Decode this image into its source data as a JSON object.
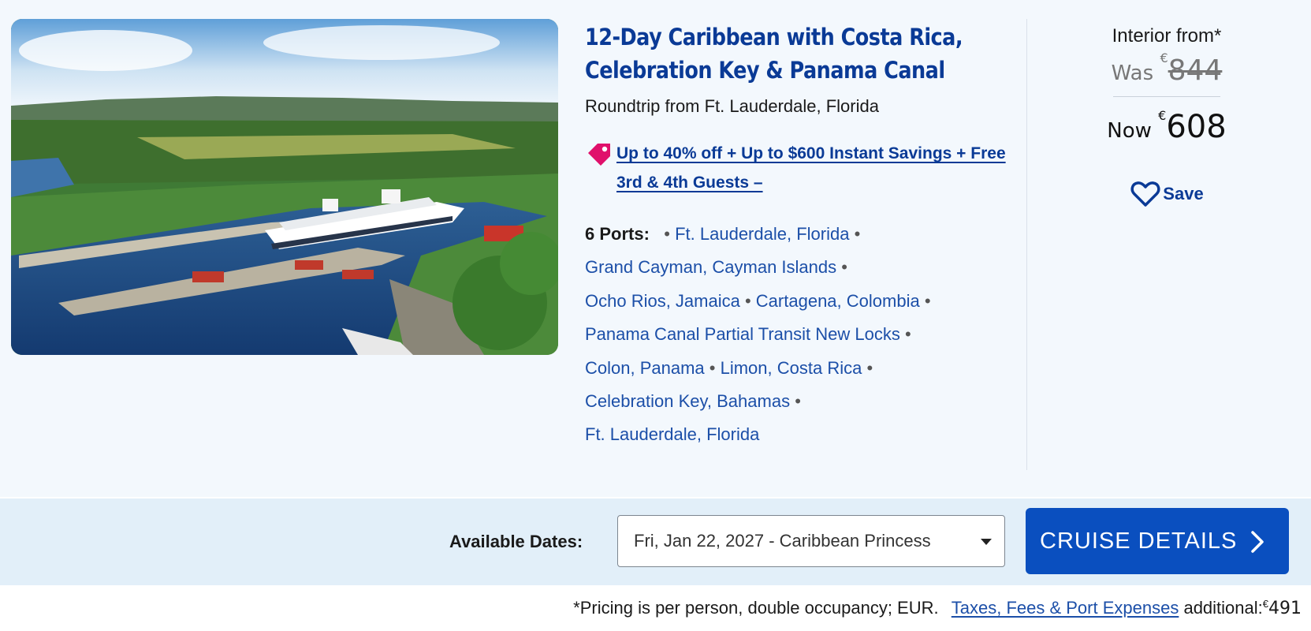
{
  "cruise": {
    "title": "12-Day Caribbean with Costa Rica, Celebration Key & Panama Canal",
    "subtitle": "Roundtrip from Ft. Lauderdale, Florida",
    "promo": "Up to 40% off + Up to $600 Instant Savings + Free 3rd & 4th Guests –",
    "ports_label": "6 Ports:",
    "ports": [
      "Ft. Lauderdale, Florida",
      "Grand Cayman, Cayman Islands",
      "Ocho Rios, Jamaica",
      "Cartagena, Colombia",
      "Panama Canal Partial Transit New Locks",
      "Colon, Panama",
      "Limon, Costa Rica",
      "Celebration Key, Bahamas",
      "Ft. Lauderdale, Florida"
    ]
  },
  "pricing": {
    "label": "Interior from*",
    "was_label": "Was",
    "currency": "€",
    "was_amount": "844",
    "now_label": "Now",
    "now_amount": "608",
    "save_label": "Save"
  },
  "dates": {
    "label": "Available Dates:",
    "selected": "Fri, Jan 22, 2027 - Caribbean Princess",
    "cta": "CRUISE DETAILS"
  },
  "footer": {
    "note": "*Pricing is per person, double occupancy; EUR.",
    "fees_link": "Taxes, Fees & Port Expenses",
    "fees_suffix": "additional:",
    "fees_currency": "€",
    "fees_amount": "491"
  },
  "colors": {
    "brand": "#0a3a96",
    "cta": "#0a4fbf",
    "tag": "#e0106b",
    "card_bg": "#f3f8fd",
    "bar_bg": "#e2eff9"
  },
  "icons": {
    "promo": "price-tag-icon",
    "save": "heart-icon",
    "select": "caret-down-icon",
    "cta": "chevron-right-icon"
  }
}
